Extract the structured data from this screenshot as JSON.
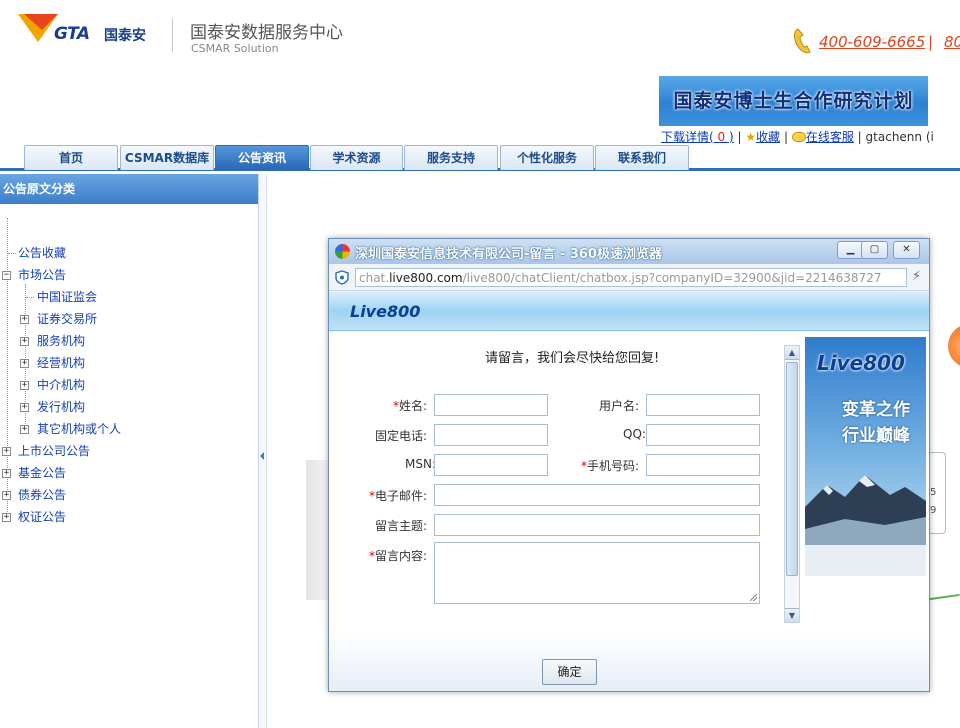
{
  "header": {
    "logo_text": "GTA",
    "logo_cn": "国泰安",
    "site_title": "国泰安数据服务中心",
    "site_subtitle": "CSMAR Solution",
    "phone": "400-609-6665",
    "phone_sep": "|",
    "phone2": "80",
    "banner_text": "国泰安博士生合作研究计划",
    "toplinks": {
      "download_label": "下载详情(",
      "download_count": " 0 ",
      "download_close": ")",
      "sep": "|",
      "favorite_label": "收藏",
      "service_label": "在线客服",
      "user": "gtachenn (i"
    }
  },
  "nav": {
    "tabs": [
      {
        "label": "首页"
      },
      {
        "label": "CSMAR数据库"
      },
      {
        "label": "公告资讯"
      },
      {
        "label": "学术资源"
      },
      {
        "label": "服务支持"
      },
      {
        "label": "个性化服务"
      },
      {
        "label": "联系我们"
      }
    ],
    "active": "公告资讯"
  },
  "sidebar": {
    "title": "公告原文分类",
    "items": [
      {
        "label": "公告收藏"
      },
      {
        "label": "市场公告"
      },
      {
        "label": "中国证监会"
      },
      {
        "label": "证券交易所"
      },
      {
        "label": "服务机构"
      },
      {
        "label": "经营机构"
      },
      {
        "label": "中介机构"
      },
      {
        "label": "发行机构"
      },
      {
        "label": "其它机构或个人"
      },
      {
        "label": "上市公司公告"
      },
      {
        "label": "基金公告"
      },
      {
        "label": "债券公告"
      },
      {
        "label": "权证公告"
      }
    ],
    "expand_symbol": "+",
    "collapse_symbol": "−"
  },
  "background": {
    "peek_1": "5",
    "peek_2": "9"
  },
  "popup": {
    "title": "深圳国泰安信息技术有限公司-留言 - 360极速浏览器",
    "win_min": "▁",
    "win_max": "▢",
    "win_close": "✕",
    "url_prefix": "chat.",
    "url_domain": "live800.com",
    "url_path": "/live800/chatClient/chatbox.jsp?companyID=32900&jid=2214638727",
    "brand": "Live800",
    "form_title": "请留言，我们会尽快给您回复!",
    "required_mark": "*",
    "fields": {
      "name": "姓名:",
      "username": "用户名:",
      "phone": "固定电话:",
      "qq": "QQ:",
      "msn": "MSN:",
      "mobile": "手机号码:",
      "email": "电子邮件:",
      "subject": "留言主题:",
      "content": "留言内容:"
    },
    "ad": {
      "logo": "Live800",
      "line1": "变革之作",
      "line2": "行业巅峰"
    },
    "submit_label": "确定"
  }
}
